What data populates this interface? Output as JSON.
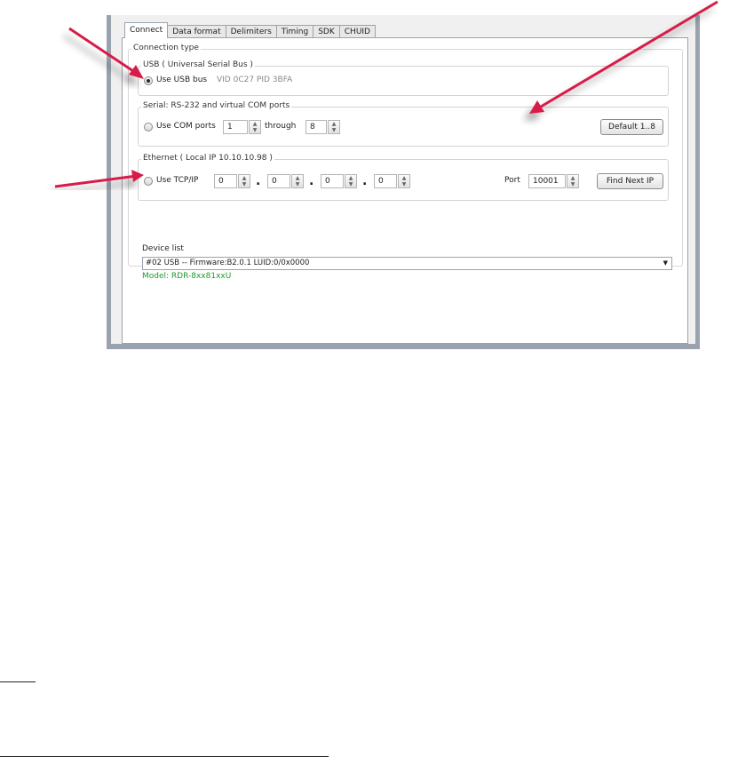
{
  "tabs": [
    "Connect",
    "Data format",
    "Delimiters",
    "Timing",
    "SDK",
    "CHUID"
  ],
  "active_tab": "Connect",
  "connection_type_label": "Connection type",
  "usb": {
    "group_label": "USB ( Universal Serial Bus )",
    "radio_label": "Use USB bus",
    "vid_pid": "VID 0C27  PID 3BFA",
    "selected": true
  },
  "serial": {
    "group_label": "Serial: RS-232 and virtual COM ports",
    "radio_label": "Use COM ports",
    "from_value": "1",
    "through_label": "through",
    "to_value": "8",
    "default_button": "Default 1..8"
  },
  "ethernet": {
    "group_label": "Ethernet ( Local IP 10.10.10.98 )",
    "radio_label": "Use TCP/IP",
    "ip": [
      "0",
      "0",
      "0",
      "0"
    ],
    "port_label": "Port",
    "port_value": "10001",
    "find_button": "Find Next IP"
  },
  "device_list": {
    "label": "Device list",
    "selected": "#02 USB -- Firmware:B2.0.1 LUID:0/0x0000",
    "model": "Model: RDR-8xx81xxU"
  },
  "colors": {
    "arrow": "#d81b4a",
    "model_text": "#1f9a2a"
  }
}
